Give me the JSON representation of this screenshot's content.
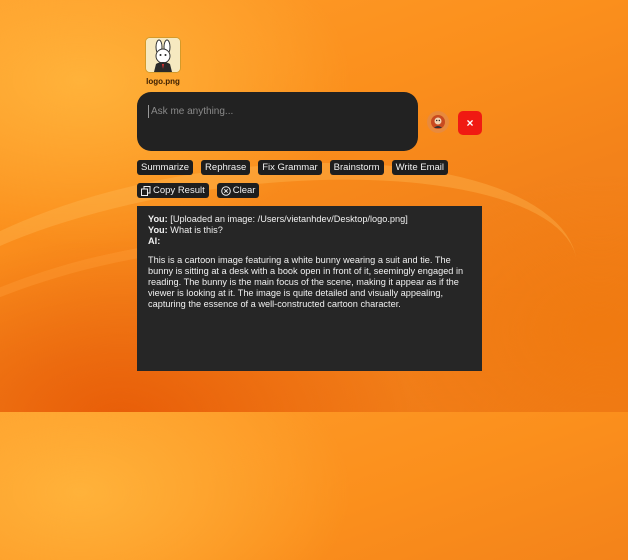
{
  "attachment": {
    "file_name": "logo.png",
    "icon": "image-thumbnail-icon"
  },
  "prompt": {
    "placeholder": "Ask me anything...",
    "value": ""
  },
  "buttons": {
    "close_label": "×",
    "actions": [
      "Summarize",
      "Rephrase",
      "Fix Grammar",
      "Brainstorm",
      "Write Email"
    ],
    "copy_result": "Copy Result",
    "clear": "Clear"
  },
  "result": {
    "you_label": "You:",
    "upload_text": "[Uploaded an image: /Users/vietanhdev/Desktop/logo.png]",
    "question_text": "What is this?",
    "ai_label": "AI:",
    "answer": "This is a cartoon image featuring a white bunny wearing a suit and tie. The bunny is sitting at a desk with a book open in front of it, seemingly engaged in reading. The bunny is the main focus of the scene, making it appear as if the viewer is looking at it. The image is quite detailed and visually appealing, capturing the essence of a well-constructed cartoon character."
  },
  "colors": {
    "close_button": "#f01a12",
    "panel_bg": "#262626",
    "accent": "#ff9d2a"
  }
}
